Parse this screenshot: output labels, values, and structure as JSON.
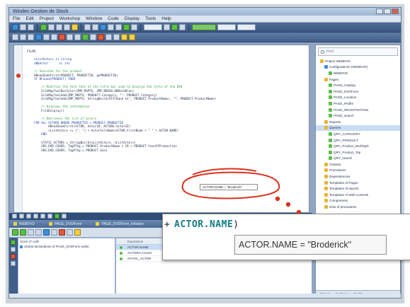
{
  "window": {
    "title": "Windev  Gestion de Stock"
  },
  "menu": [
    "File",
    "Edit",
    "Project",
    "Workshop",
    "Window",
    "Code",
    "Display",
    "Tools",
    "Help"
  ],
  "editor": {
    "lines": [
      {
        "kind": "tx",
        "text": "FILMS"
      },
      {
        "kind": "tx",
        "text": ""
      },
      {
        "kind": "kw",
        "text": "    sListActors is string"
      },
      {
        "kind": "kw",
        "text": "    nNbActor      is int"
      },
      {
        "kind": "tx",
        "text": ""
      },
      {
        "kind": "cm",
        "text": "    // Searches for the product"
      },
      {
        "kind": "tx",
        "text": "    HReadSeekFirst(PRODUCT, PRODUCTID, gnPRODUCTID)"
      },
      {
        "kind": "kw",
        "text": "    IF HFound(PRODUCT) THEN"
      },
      {
        "kind": "tx",
        "text": ""
      },
      {
        "kind": "cm",
        "text": "        // Modifies the text font of the title bar used to display the title of the DVD"
      },
      {
        "kind": "tx",
        "text": "        SilkMapToolBarColor(ZMP_MAPTX, ZMP_BRUSH.ONDarkBlue)"
      },
      {
        "kind": "tx",
        "text": "        SilkMapToolAdd(ZMP_MAPTX, PRODUCT.Category, \"\", PRODUCT.Category)"
      },
      {
        "kind": "tx",
        "text": "        SilkMapToolAdd(ZMP_MAPTX, StringBuild(STI(Rank %1\", PRODUCT.ProductName), \"\", PRODUCT.ProductName)"
      },
      {
        "kind": "tx",
        "text": ""
      },
      {
        "kind": "cm",
        "text": "        // Displays the information"
      },
      {
        "kind": "tx",
        "text": "        FileDisplay()"
      },
      {
        "kind": "tx",
        "text": ""
      },
      {
        "kind": "cm",
        "text": "        // Retrieves the list of actors"
      },
      {
        "kind": "kw",
        "text": "    FOR ALL ACTORS WHERE PRODUCTID = PRODUCT.PRODUCTID"
      },
      {
        "kind": "tx",
        "text": "            HReadSeekFirst(ACTOR, ActorID, ACTORS.ActorID)"
      },
      {
        "kind": "tx",
        "text": "            sListActors += [\", \"] + ActorFullName(ACTOR.FirstName + \" \" + ACTOR.NAME)"
      },
      {
        "kind": "kw",
        "text": "        END"
      },
      {
        "kind": "tx",
        "text": ""
      },
      {
        "kind": "tx",
        "text": "        STATIC_ACTORS = StringBuild(sListActors, sListActors)"
      },
      {
        "kind": "tx",
        "text": "        SRS_DVD_COVER, TagPThg = PRODUCT.ProductName + CR + PRODUCT.YearOfProduction"
      },
      {
        "kind": "tx",
        "text": "        SRS_DVD_COVER, TagPThg = PRODUCT.Sale"
      }
    ]
  },
  "tree": {
    "search_placeholder": "Find",
    "items": [
      {
        "indent": 1,
        "label": "Project WEBDVD",
        "color": "#e6b632"
      },
      {
        "indent": 2,
        "label": "Configurations (WEBDVD)",
        "color": "#3f8fd9"
      },
      {
        "indent": 3,
        "label": "WEBDVD",
        "color": "#5bbf46"
      },
      {
        "indent": 2,
        "label": "Pages",
        "color": "#e6b632"
      },
      {
        "indent": 3,
        "label": "PAGE_Catalog",
        "color": "#5bbf46"
      },
      {
        "indent": 3,
        "label": "PAGE_DVDForm",
        "color": "#5bbf46"
      },
      {
        "indent": 3,
        "label": "PAGE_Location",
        "color": "#5bbf46"
      },
      {
        "indent": 3,
        "label": "PAGE_Profile",
        "color": "#5bbf46"
      },
      {
        "indent": 3,
        "label": "PAGE_REGISTRATION",
        "color": "#5bbf46"
      },
      {
        "indent": 3,
        "label": "PAGE_search",
        "color": "#5bbf46"
      },
      {
        "indent": 2,
        "label": "Reports",
        "color": "#e6b632"
      },
      {
        "indent": 2,
        "label": "Queries",
        "color": "#e6b632",
        "selected": true
      },
      {
        "indent": 3,
        "label": "QRY_CATEGORY",
        "color": "#5bbf46"
      },
      {
        "indent": 3,
        "label": "QRY_PRODUCT",
        "color": "#5bbf46"
      },
      {
        "indent": 3,
        "label": "QRY_Product_DvdTopD",
        "color": "#5bbf46"
      },
      {
        "indent": 3,
        "label": "QRY_Product_Top",
        "color": "#5bbf46"
      },
      {
        "indent": 3,
        "label": "QRY_search",
        "color": "#5bbf46"
      },
      {
        "indent": 2,
        "label": "Classes",
        "color": "#e6b632"
      },
      {
        "indent": 2,
        "label": "Procedures",
        "color": "#e6b632"
      },
      {
        "indent": 2,
        "label": "Dependencies",
        "color": "#e6b632"
      },
      {
        "indent": 2,
        "label": "Templates of Pages",
        "color": "#e6b632"
      },
      {
        "indent": 2,
        "label": "Templates of reports",
        "color": "#e6b632"
      },
      {
        "indent": 2,
        "label": "Templates of Web Controls",
        "color": "#e6b632"
      },
      {
        "indent": 2,
        "label": "Components",
        "color": "#e6b632"
      },
      {
        "indent": 2,
        "label": "Sets of procedures",
        "color": "#e6b632"
      }
    ],
    "footer": [
      "Project",
      "Explorer",
      "PAGE"
    ]
  },
  "debugger": {
    "tabs": [
      "WEBDVD",
      "PAGE_DVDForm",
      "PAGE_DVDForm_Initialize"
    ],
    "stack_header": "Stack of calls",
    "stack_rows": [
      "Global declarations of PAGE_DVDForm (with)"
    ],
    "columns": [
      "",
      "Expression",
      "Value",
      ""
    ],
    "rows": [
      {
        "expression": "ACTOR.NAME",
        "value": "",
        "selected": true
      },
      {
        "expression": "ACTORS.Actorid",
        "value": "Maldham",
        "selected": false
      },
      {
        "expression": "STATIC_ACTOR",
        "value": "\"Larry Castle Rakayow, 1 Jenny, 1 Rand\"",
        "selected": false
      }
    ]
  },
  "callout": {
    "small_tooltip": "ACTOR.NAME = \"Broderick\"",
    "zoom_plus": "+",
    "zoom_expression": "ACTOR.NAME",
    "zoom_close": ")",
    "zoom_tooltip": "ACTOR.NAME = \"Broderick\"",
    "accent": "#d8331f"
  }
}
